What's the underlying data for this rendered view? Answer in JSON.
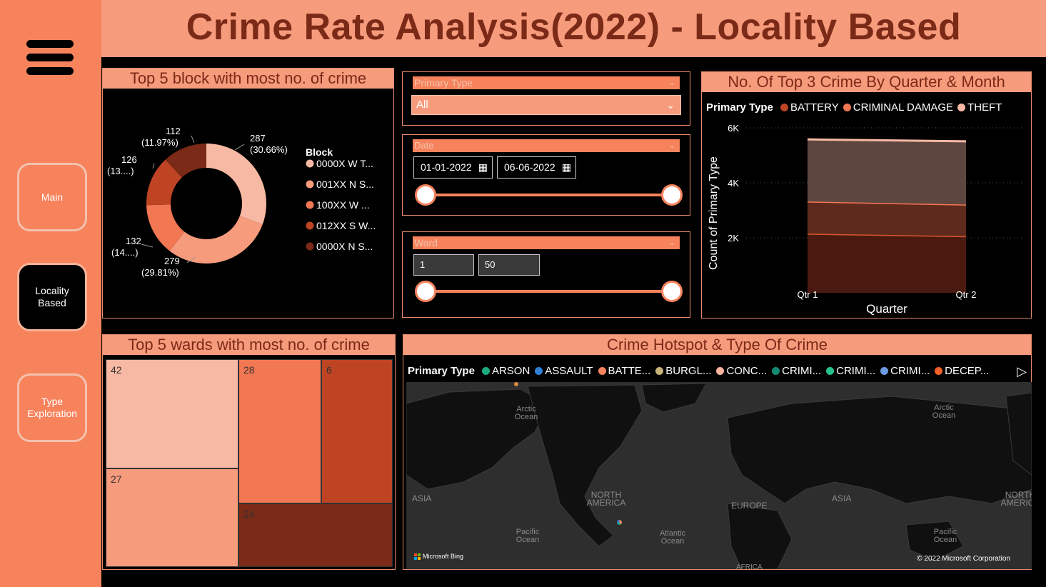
{
  "header": {
    "title": "Crime Rate Analysis(2022) - Locality Based"
  },
  "sidebar": {
    "items": [
      {
        "label": "Main",
        "active": false
      },
      {
        "label": "Locality Based",
        "active": true
      },
      {
        "label": "Type Exploration",
        "active": false
      }
    ]
  },
  "donut": {
    "title": "Top 5 block with most no. of crime",
    "legend_title": "Block",
    "labels": [
      {
        "value": "287",
        "pct": "(30.66%)"
      },
      {
        "value": "279",
        "pct": "(29.81%)"
      },
      {
        "value": "132",
        "pct": "(14....)"
      },
      {
        "value": "126",
        "pct": "(13....)"
      },
      {
        "value": "112",
        "pct": "(11.97%)"
      }
    ],
    "legend": [
      "0000X W T...",
      "001XX N S...",
      "100XX W ...",
      "012XX S W...",
      "0000X N S..."
    ]
  },
  "filters": {
    "primary_type": {
      "label": "Primary Type",
      "value": "All"
    },
    "date": {
      "label": "Date",
      "start": "01-01-2022",
      "end": "06-06-2022"
    },
    "ward": {
      "label": "Ward",
      "min": "1",
      "max": "50"
    }
  },
  "area_chart": {
    "title": "No. Of Top 3 Crime By Quarter & Month",
    "legend_title": "Primary Type",
    "y_ticks": [
      "6K",
      "4K",
      "2K"
    ],
    "x_ticks": [
      "Qtr 1",
      "Qtr 2"
    ]
  },
  "treemap": {
    "title": "Top 5 wards with most no. of crime"
  },
  "map": {
    "title": "Crime Hotspot & Type Of Crime",
    "legend_title": "Primary Type",
    "legend": [
      {
        "label": "ARSON",
        "color": "#1AAB7E"
      },
      {
        "label": "ASSAULT",
        "color": "#2F7FD6"
      },
      {
        "label": "BATTE...",
        "color": "#F7835C"
      },
      {
        "label": "BURGL...",
        "color": "#C9B27A"
      },
      {
        "label": "CONC...",
        "color": "#F8B49E"
      },
      {
        "label": "CRIMI...",
        "color": "#128A74"
      },
      {
        "label": "CRIMI...",
        "color": "#24C28F"
      },
      {
        "label": "CRIMI...",
        "color": "#6E9BE6"
      },
      {
        "label": "DECEP...",
        "color": "#F4602A"
      }
    ],
    "labels": {
      "arctic1": "Arctic Ocean",
      "arctic2": "Arctic Ocean",
      "asia1": "ASIA",
      "north_america": "NORTH AMERICA",
      "europe": "EUROPE",
      "asia2": "ASIA",
      "north_america2": "NORTH AMERICA",
      "pacific1": "Pacific Ocean",
      "atlantic": "Atlantic Ocean",
      "pacific2": "Pacific Ocean",
      "africa": "AFRICA"
    },
    "bing": "Microsoft Bing",
    "copyright": "© 2022 Microsoft Corporation"
  },
  "chart_data": [
    {
      "type": "pie",
      "title": "Top 5 block with most no. of crime",
      "legend_title": "Block",
      "categories": [
        "0000X W T...",
        "001XX N S...",
        "100XX W ...",
        "012XX S W...",
        "0000X N S..."
      ],
      "values": [
        287,
        279,
        132,
        126,
        112
      ],
      "colors": [
        "#F8B9A4",
        "#F79B7D",
        "#F27753",
        "#BF4424",
        "#7A2A17"
      ],
      "legend_position": "right"
    },
    {
      "type": "area",
      "title": "No. Of Top 3 Crime By Quarter & Month",
      "xlabel": "Quarter",
      "ylabel": "Count of Primary Type",
      "categories": [
        "Qtr 1",
        "Qtr 2"
      ],
      "ylim": [
        0,
        6000
      ],
      "series": [
        {
          "name": "BATTERY",
          "color": "#BF4424",
          "values": [
            2150,
            2060
          ]
        },
        {
          "name": "CRIMINAL DAMAGE",
          "color": "#F27753",
          "values": [
            1170,
            1150
          ]
        },
        {
          "name": "THEFT",
          "color": "#F8B9A4",
          "values": [
            2260,
            2300
          ]
        }
      ],
      "stacked": true,
      "legend_position": "top"
    },
    {
      "type": "treemap",
      "title": "Top 5 wards with most no. of crime",
      "categories": [
        "42",
        "27",
        "28",
        "24",
        "6"
      ],
      "colors": [
        "#F8B9A4",
        "#F79B7D",
        "#F27753",
        "#7A2A17",
        "#BF4424"
      ]
    }
  ]
}
